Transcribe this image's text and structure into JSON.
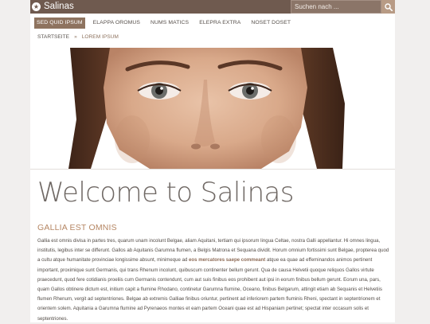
{
  "site": {
    "title": "Salinas",
    "logo_icon": "star-icon"
  },
  "search": {
    "placeholder": "Suchen nach ...",
    "icon": "search-icon"
  },
  "nav": {
    "items": [
      {
        "label": "SED QUID IPSUM",
        "active": true
      },
      {
        "label": "ELAPPA OROMUS",
        "active": false
      },
      {
        "label": "NUMS MATICS",
        "active": false
      },
      {
        "label": "ELEPRA EXTRA",
        "active": false
      },
      {
        "label": "NOSET DOSET",
        "active": false
      }
    ]
  },
  "breadcrumb": {
    "home": "STARTSEITE",
    "separator": "»",
    "current": "LOREM IPSUM"
  },
  "hero": {
    "image": "woman-face-portrait"
  },
  "main": {
    "headline": "Welcome to Salinas",
    "section_title": "GALLIA EST OMNIS",
    "paragraph_before": "Gallia est omnis divisa in partes tres, quarum unam incolunt Belgae, aliam Aquitani, tertiam qui ipsorum lingua Celtae, nostra Galli appellantur. Hi omnes lingua, institutis, legibus inter se differunt. Gallos ab Aquitanis Garumna flumen, a Belgis Matrona et Sequana dividit. Horum omnium fortissimi sunt Belgae, propterea quod a cultu atque humanitate provinciae longissime absunt, minimeque ad",
    "paragraph_highlight": "eos mercatores saepe commeant",
    "paragraph_after": "atque ea quae ad effeminandos animos pertinent important, proximique sunt Germanis, qui trans Rhenum incolunt, quibuscum continenter bellum gerunt. Qua de causa Helvetii quoque reliquos Gallos virtute praecedunt, quod fere cotidianis proeliis cum Germanis contendunt, cum aut suis finibus eos prohibent aut ipsi in eorum finibus bellum gerunt. Eorum una, pars, quam Gallos obtinere dictum est, initium capit a flumine Rhodano, continetur Garumna flumine, Oceano, finibus Belgarum, attingit etiam ab Sequanis et Helvetiis flumen Rhenum, vergit ad septentriones. Belgae ab extremis Galliae finibus oriuntur, pertinent ad inferiorem partem fluminis Rheni, spectant in septentrionem et orientem solem. Aquitania a Garumna flumine ad Pyrenaeos montes et eam partem Oceani quae est ad Hispaniam pertinet; spectat inter occasum solis et septentriones."
  },
  "colors": {
    "topbar": "#6f5a4f",
    "accent": "#8e735f",
    "section_title": "#b58663",
    "background": "#f1efee"
  }
}
